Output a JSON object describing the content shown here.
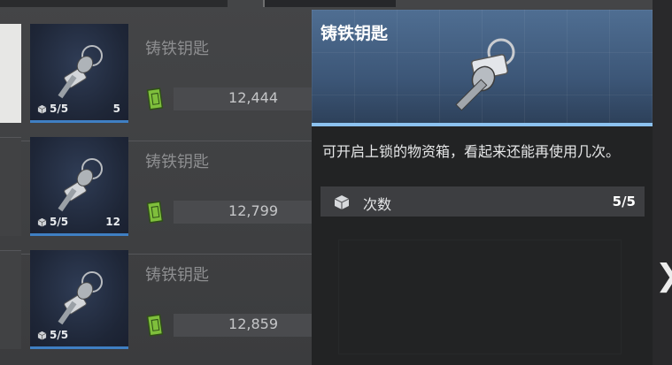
{
  "items": [
    {
      "name": "铸铁钥匙",
      "quantity": "5/5",
      "count": "5",
      "price": "12,444"
    },
    {
      "name": "铸铁钥匙",
      "quantity": "5/5",
      "count": "12",
      "price": "12,799"
    },
    {
      "name": "铸铁钥匙",
      "quantity": "5/5",
      "count": "",
      "price": "12,859"
    }
  ],
  "tooltip": {
    "title": "铸铁钥匙",
    "description": "可开启上锁的物资箱，看起来还能再使用几次。",
    "stat_label": "次数",
    "stat_value": "5/5"
  },
  "icons": {
    "item": "iron-key-icon",
    "quantity": "box-icon",
    "price": "cash-icon",
    "stat": "cube-icon",
    "next": "chevron-right-icon"
  },
  "colors": {
    "tile_accent": "#3f7fc3",
    "tooltip_header": "#4f6e92",
    "tooltip_glow": "#8cc2f0"
  }
}
